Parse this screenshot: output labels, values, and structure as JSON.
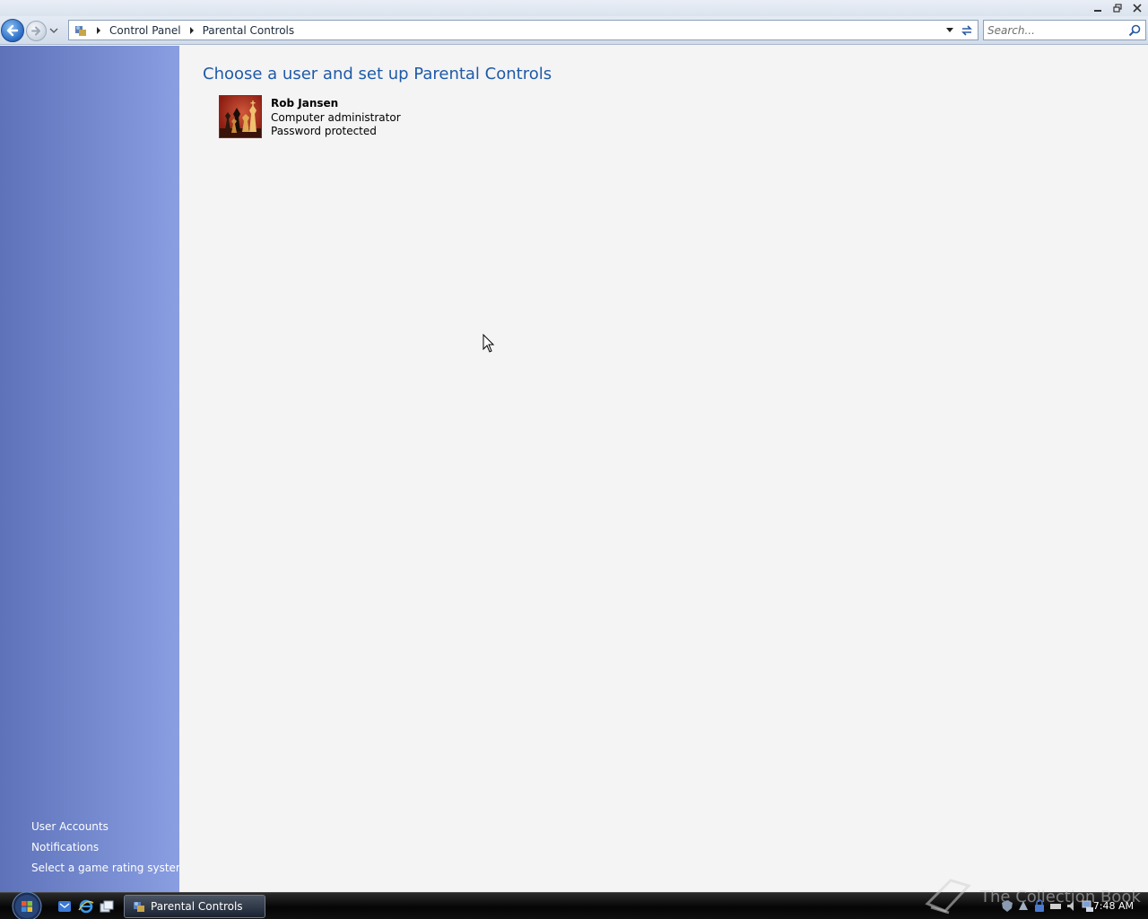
{
  "window": {
    "controls": [
      "minimize",
      "restore",
      "close"
    ]
  },
  "navigation": {
    "breadcrumbs": [
      "Control Panel",
      "Parental Controls"
    ],
    "search_placeholder": "Search..."
  },
  "left_pane": {
    "see_also": [
      "User Accounts",
      "Notifications",
      "Select a game rating system"
    ]
  },
  "main": {
    "title": "Choose a user and set up Parental Controls",
    "users": [
      {
        "name": "Rob Jansen",
        "role": "Computer administrator",
        "status": "Password protected",
        "avatar_icon": "chess-pieces-avatar"
      }
    ]
  },
  "taskbar": {
    "active_task": "Parental Controls",
    "watermark": "The Collection Book",
    "clock": "7:48 AM"
  },
  "colors": {
    "accent_title": "#1e5aa8",
    "left_pane_start": "#5d72b9",
    "left_pane_end": "#8a9ee2"
  }
}
